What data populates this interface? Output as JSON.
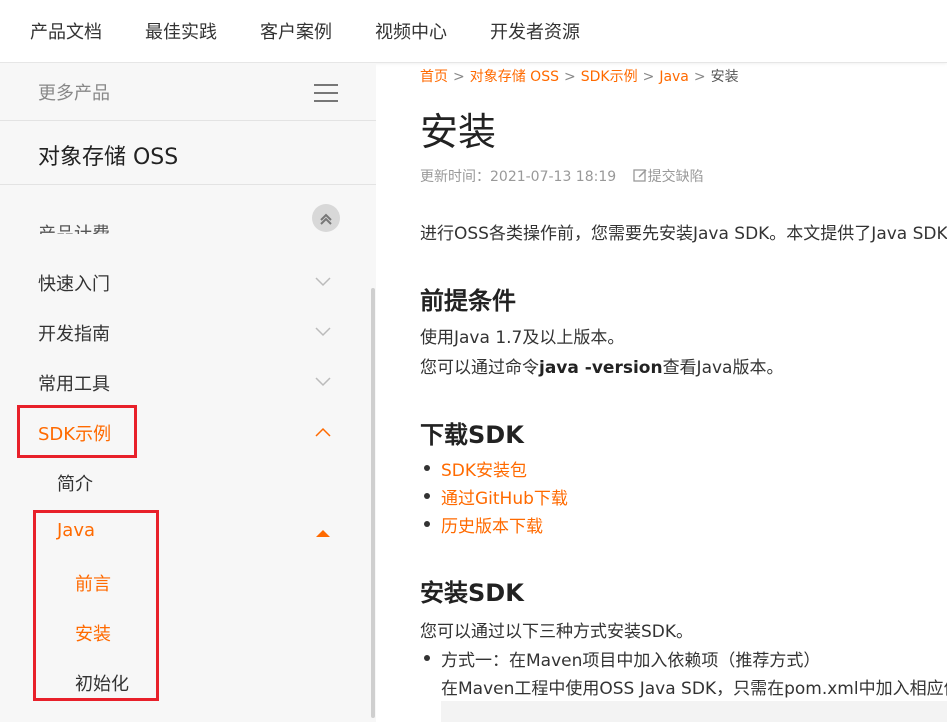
{
  "topnav": {
    "items": [
      "产品文档",
      "最佳实践",
      "客户案例",
      "视频中心",
      "开发者资源"
    ]
  },
  "sidebar": {
    "more_products": "更多产品",
    "product_title": "对象存储 OSS",
    "cut_item": "产品计费",
    "items": [
      {
        "label": "快速入门"
      },
      {
        "label": "开发指南"
      },
      {
        "label": "常用工具"
      },
      {
        "label": "SDK示例"
      },
      {
        "label": "简介"
      },
      {
        "label": "Java"
      },
      {
        "label": "前言"
      },
      {
        "label": "安装"
      },
      {
        "label": "初始化"
      }
    ]
  },
  "content": {
    "breadcrumb": [
      "首页",
      "对象存储 OSS",
      "SDK示例",
      "Java",
      "安装"
    ],
    "title": "安装",
    "updated": "更新时间：2021-07-13 18:19",
    "report_link": "提交缺陷",
    "intro": "进行OSS各类操作前，您需要先安装Java SDK。本文提供了Java SDK",
    "prereq": {
      "heading": "前提条件",
      "line1": "使用Java 1.7及以上版本。",
      "line2_pre": "您可以通过命令",
      "line2_cmd": "java -version",
      "line2_post": "查看Java版本。"
    },
    "download": {
      "heading": "下载SDK",
      "links": [
        "SDK安装包",
        "通过GitHub下载",
        "历史版本下载"
      ]
    },
    "install": {
      "heading": "安装SDK",
      "line1": "您可以通过以下三种方式安装SDK。",
      "item1": "方式一：在Maven项目中加入依赖项（推荐方式）",
      "item1_sub": "在Maven工程中使用OSS Java SDK，只需在pom.xml中加入相应依"
    }
  },
  "colors": {
    "accent": "#ff6a00",
    "highlight_box": "#e8202a"
  }
}
